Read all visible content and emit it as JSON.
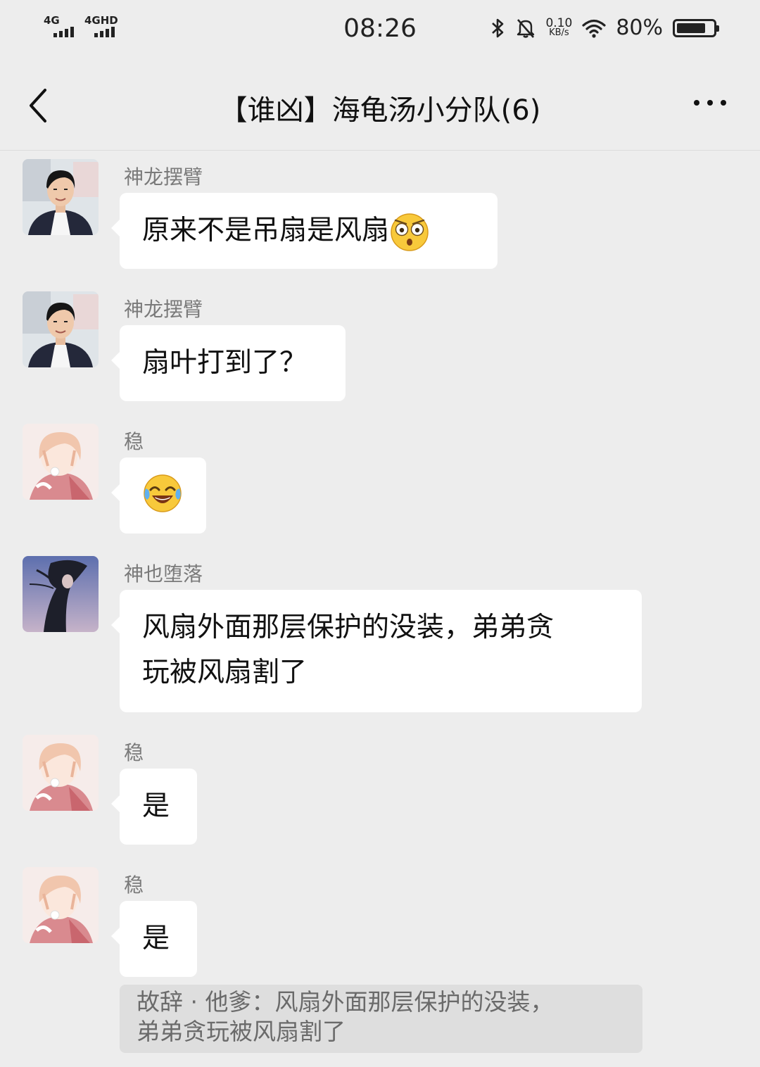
{
  "status_bar": {
    "signal_1": "4G",
    "signal_2": "4GHD",
    "time": "08:26",
    "net_speed_value": "0.10",
    "net_speed_unit": "KB/s",
    "battery_text": "80%",
    "battery_level": 0.8
  },
  "header": {
    "title": "【谁凶】海龟汤小分队(6)"
  },
  "messages": [
    {
      "sender": "神龙摆臂",
      "text": "原来不是吊扇是风扇",
      "emoji": "flushed-face-emoji"
    },
    {
      "sender": "神龙摆臂",
      "text": "扇叶打到了？"
    },
    {
      "sender": "稳",
      "text": "",
      "emoji": "tears-of-joy-emoji"
    },
    {
      "sender": "神也堕落",
      "line1": "风扇外面那层保护的没装，弟弟贪",
      "line2": "玩被风扇割了"
    },
    {
      "sender": "稳",
      "text": "是"
    },
    {
      "sender": "稳",
      "text": "是"
    }
  ],
  "quote": {
    "line1": "故辞 · 他爹：风扇外面那层保护的没装，",
    "line2": "弟弟贪玩被风扇割了"
  }
}
